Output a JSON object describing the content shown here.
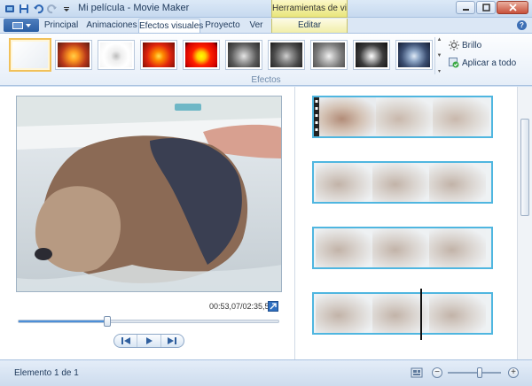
{
  "window": {
    "title": "Mi película - Movie Maker",
    "context_tab_header": "Herramientas de video"
  },
  "tabs": [
    {
      "label": "Principal"
    },
    {
      "label": "Animaciones"
    },
    {
      "label": "Efectos visuales",
      "active": true
    },
    {
      "label": "Proyecto"
    },
    {
      "label": "Ver"
    },
    {
      "label": "Editar",
      "contextual": true
    }
  ],
  "ribbon": {
    "group_label": "Efectos",
    "effects": [
      {
        "name": "none",
        "selected": true
      },
      {
        "name": "warm"
      },
      {
        "name": "sketch"
      },
      {
        "name": "saturated"
      },
      {
        "name": "posterize"
      },
      {
        "name": "grayscale"
      },
      {
        "name": "grayscale-dark"
      },
      {
        "name": "grayscale-light"
      },
      {
        "name": "grayscale-contrast"
      },
      {
        "name": "cyan-tone"
      }
    ],
    "brightness_label": "Brillo",
    "apply_all_label": "Aplicar a todo"
  },
  "preview": {
    "timecode": "00:53,07/02:35,52",
    "seek_progress": 0.34
  },
  "storyboard": {
    "clips": [
      {
        "index": 1
      },
      {
        "index": 2
      },
      {
        "index": 3
      },
      {
        "index": 4
      }
    ]
  },
  "status": {
    "item_text": "Elemento 1 de 1",
    "zoom_level": 0.6
  },
  "colors": {
    "accent": "#4fb6e0",
    "selection": "#f1c15a",
    "file_button": "#2a5ea4"
  }
}
